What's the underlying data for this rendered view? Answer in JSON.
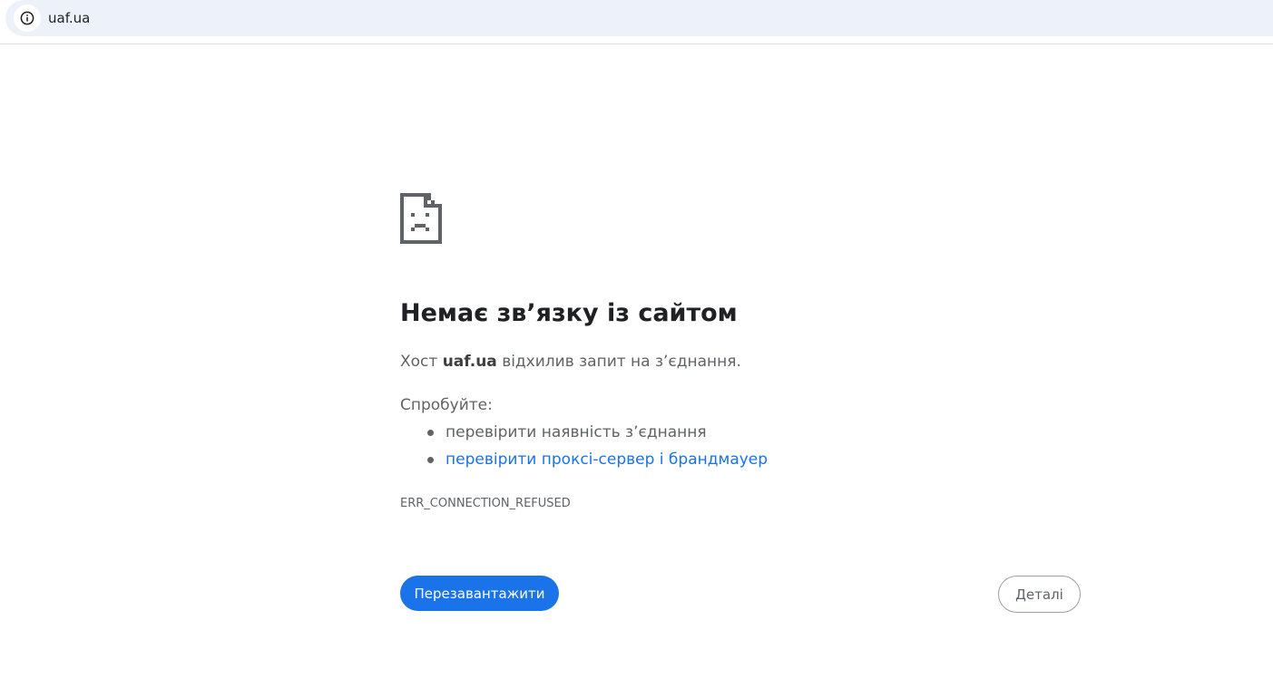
{
  "address_bar": {
    "url": "uaf.ua",
    "info_icon": "info-circle-icon"
  },
  "error_page": {
    "icon": "sad-document-icon",
    "title": "Немає звʼязку із сайтом",
    "summary_prefix": "Хост",
    "summary_host": "uaf.ua",
    "summary_suffix": "відхилив запит на зʼєднання.",
    "try_label": "Спробуйте:",
    "suggestions": [
      "перевірити наявність зʼєднання",
      "перевірити проксі-сервер і брандмауер"
    ],
    "error_code": "ERR_CONNECTION_REFUSED",
    "reload_label": "Перезавантажити",
    "details_label": "Деталі"
  },
  "colors": {
    "accent": "#1a73e8",
    "text_secondary": "#5f6368",
    "address_bar_bg": "#edf2fa"
  }
}
